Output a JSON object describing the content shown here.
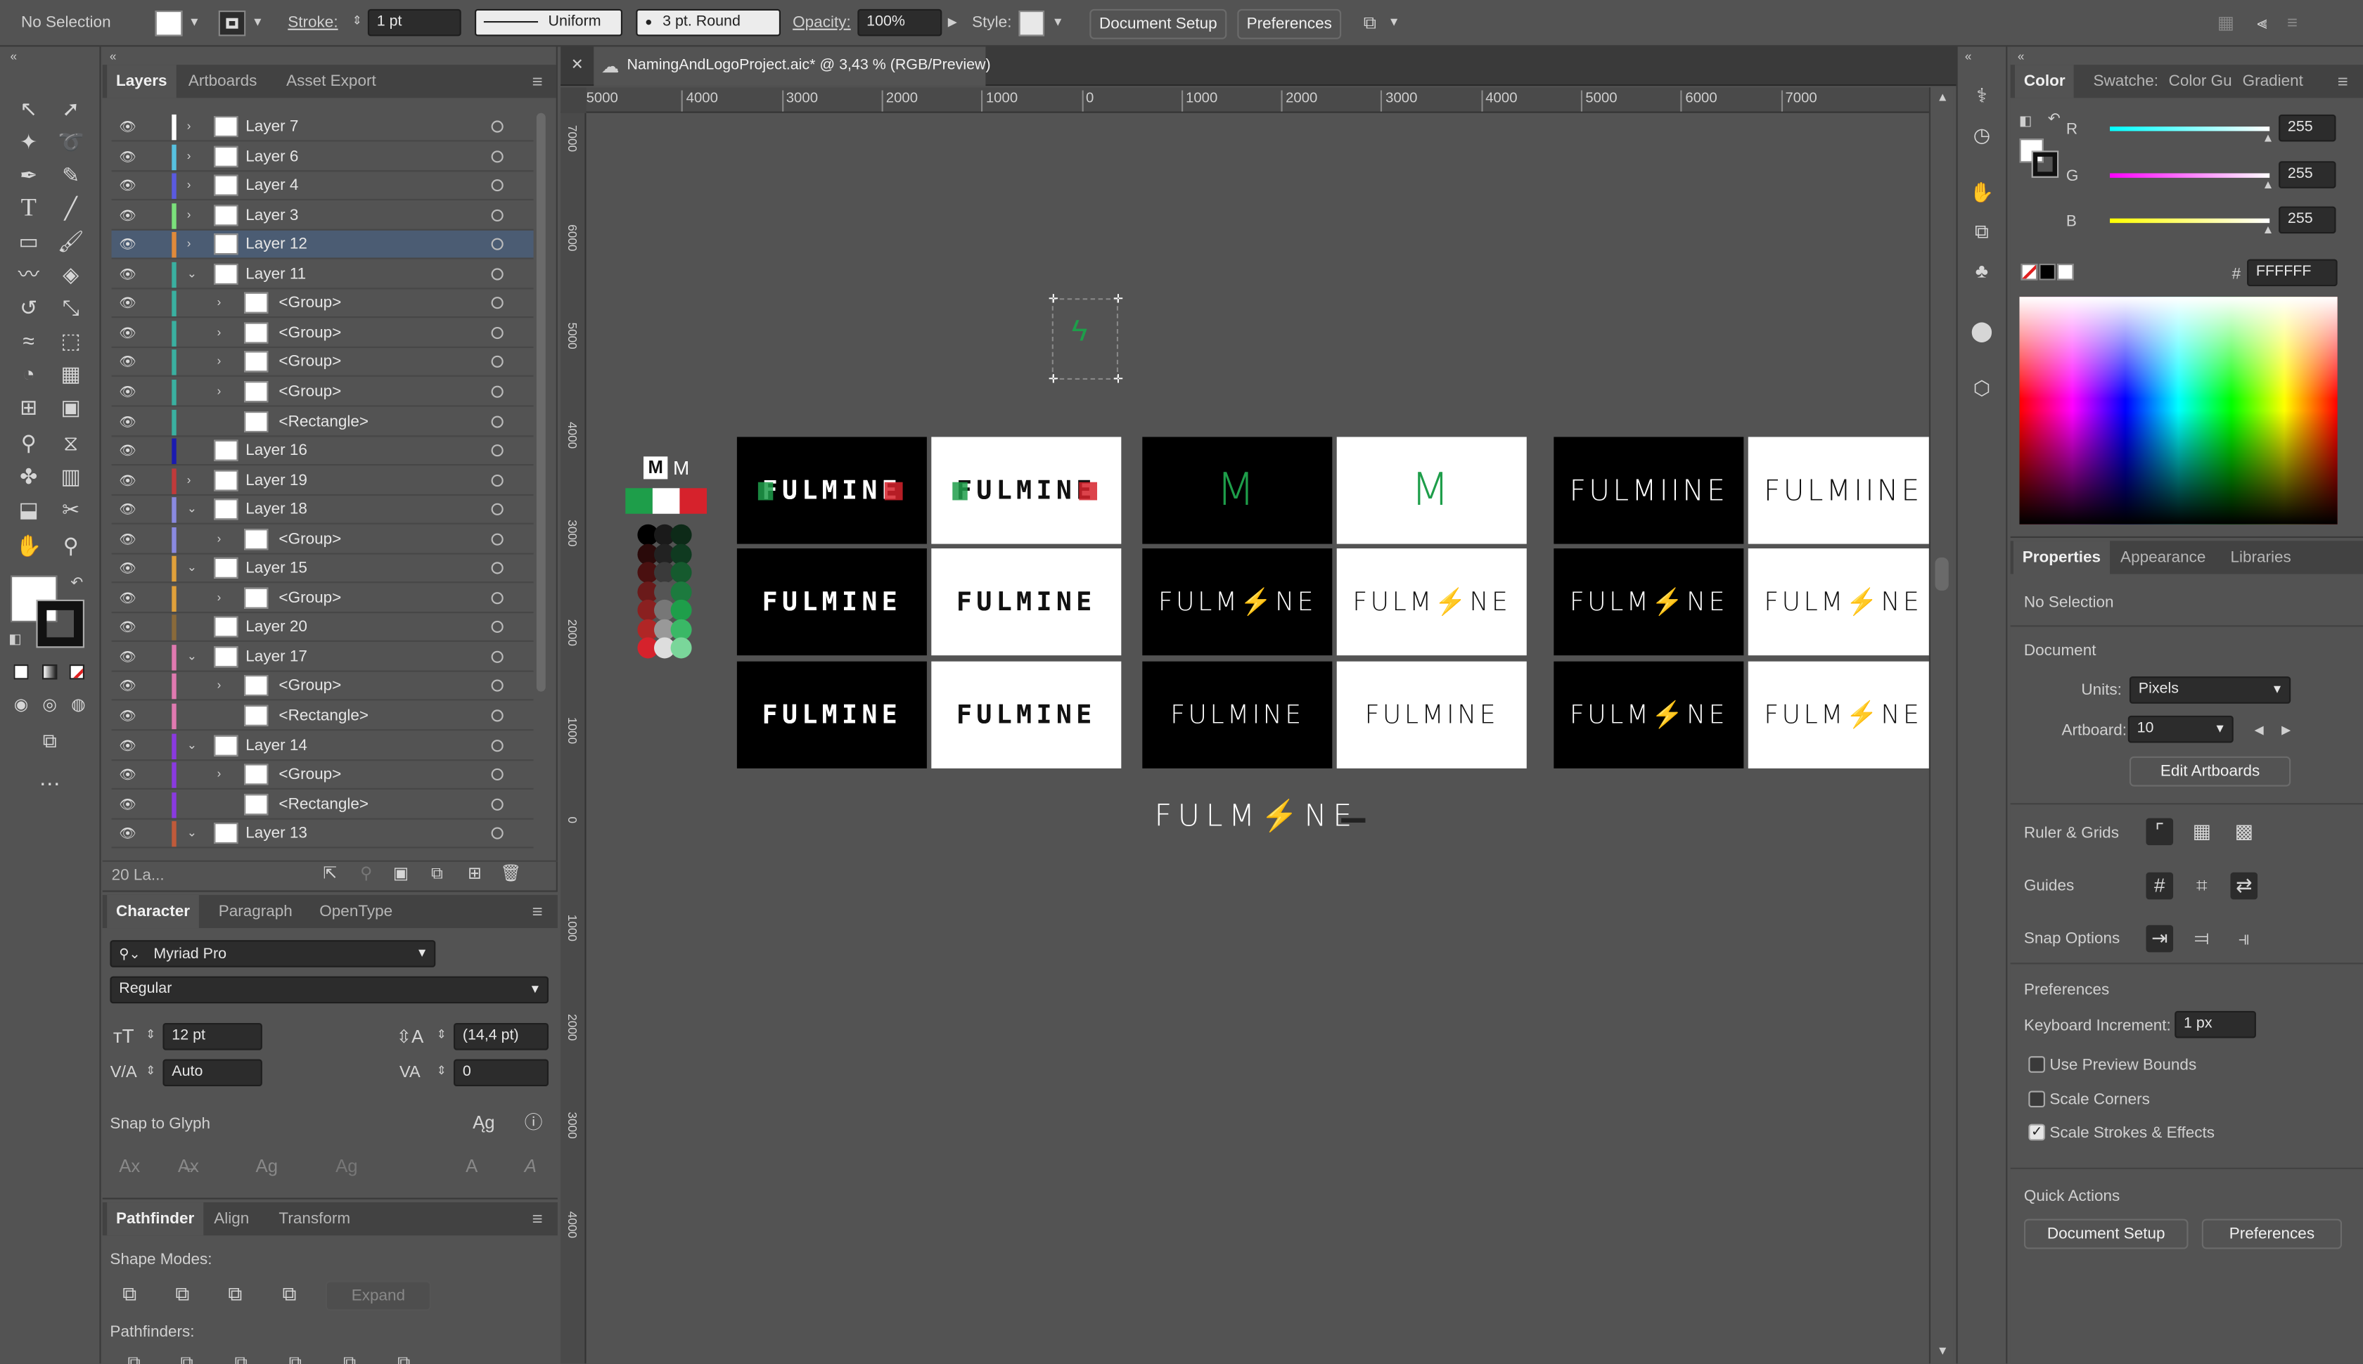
{
  "control_bar": {
    "selection": "No Selection",
    "stroke_label": "Stroke:",
    "stroke_weight": "1 pt",
    "stroke_profile": "Uniform",
    "brush": "3 pt. Round",
    "opacity_label": "Opacity:",
    "opacity_value": "100%",
    "style_label": "Style:",
    "document_setup": "Document Setup",
    "preferences": "Preferences"
  },
  "document_tab": {
    "title": "NamingAndLogoProject.aic* @ 3,43 % (RGB/Preview)"
  },
  "ruler": {
    "top_ticks": [
      "5000",
      "4000",
      "3000",
      "2000",
      "1000",
      "0",
      "1000",
      "2000",
      "3000",
      "4000",
      "5000",
      "6000",
      "7000"
    ],
    "left_ticks": [
      "7000",
      "6000",
      "5000",
      "4000",
      "3000",
      "2000",
      "1000",
      "0",
      "1000",
      "2000",
      "3000",
      "4000"
    ]
  },
  "layers_panel": {
    "tabs": [
      "Layers",
      "Artboards",
      "Asset Export"
    ],
    "rows": [
      {
        "name": "Layer 7",
        "color": "#ffffff"
      },
      {
        "name": "Layer 6",
        "color": "#57c1e0"
      },
      {
        "name": "Layer 4",
        "color": "#5a5ae0"
      },
      {
        "name": "Layer 3",
        "color": "#7be07b"
      },
      {
        "name": "Layer 12",
        "color": "#e08a3a"
      },
      {
        "name": "Layer 11",
        "color": "#3ab0a0"
      },
      {
        "name": "<Group>",
        "color": "#3ab0a0"
      },
      {
        "name": "<Group>",
        "color": "#3ab0a0"
      },
      {
        "name": "<Group>",
        "color": "#3ab0a0"
      },
      {
        "name": "<Group>",
        "color": "#3ab0a0"
      },
      {
        "name": "<Rectangle>",
        "color": "#3ab0a0"
      },
      {
        "name": "Layer 16",
        "color": "#1a1ab0"
      },
      {
        "name": "Layer 19",
        "color": "#c03a3a"
      },
      {
        "name": "Layer 18",
        "color": "#8a8ae0"
      },
      {
        "name": "<Group>",
        "color": "#8a8ae0"
      },
      {
        "name": "Layer 15",
        "color": "#e0a03a"
      },
      {
        "name": "<Group>",
        "color": "#e0a03a"
      },
      {
        "name": "Layer 20",
        "color": "#8a6a3a"
      },
      {
        "name": "Layer 17",
        "color": "#e07ab0"
      },
      {
        "name": "<Group>",
        "color": "#e07ab0"
      },
      {
        "name": "<Rectangle>",
        "color": "#e07ab0"
      },
      {
        "name": "Layer 14",
        "color": "#8a3ae0"
      },
      {
        "name": "<Group>",
        "color": "#8a3ae0"
      },
      {
        "name": "<Rectangle>",
        "color": "#8a3ae0"
      },
      {
        "name": "Layer 13",
        "color": "#c05a3a"
      }
    ],
    "footer_count": "20 La..."
  },
  "character_panel": {
    "tabs": [
      "Character",
      "Paragraph",
      "OpenType"
    ],
    "font_family": "Myriad Pro",
    "font_style": "Regular",
    "font_size": "12 pt",
    "leading": "(14,4 pt)",
    "kerning": "Auto",
    "tracking": "0",
    "snap_to_glyph": "Snap to Glyph"
  },
  "pathfinder_panel": {
    "tabs": [
      "Pathfinder",
      "Align",
      "Transform"
    ],
    "shape_modes": "Shape Modes:",
    "expand": "Expand",
    "pathfinders": "Pathfinders:"
  },
  "color_panel": {
    "tabs": [
      "Color",
      "Swatche:",
      "Color Gu",
      "Gradient"
    ],
    "r_label": "R",
    "g_label": "G",
    "b_label": "B",
    "r": "255",
    "g": "255",
    "b": "255",
    "hex_label": "#",
    "hex": "FFFFFF"
  },
  "properties_panel": {
    "tabs": [
      "Properties",
      "Appearance",
      "Libraries"
    ],
    "selection": "No Selection",
    "document_heading": "Document",
    "units_label": "Units:",
    "units_value": "Pixels",
    "artboard_label": "Artboard:",
    "artboard_value": "10",
    "edit_artboards": "Edit Artboards",
    "ruler_grids": "Ruler & Grids",
    "guides": "Guides",
    "snap_options": "Snap Options",
    "preferences_heading": "Preferences",
    "keyboard_increment_label": "Keyboard Increment:",
    "keyboard_increment_value": "1 px",
    "use_preview_bounds": "Use Preview Bounds",
    "scale_corners": "Scale Corners",
    "scale_strokes": "Scale Strokes & Effects",
    "quick_actions": "Quick Actions",
    "document_setup_btn": "Document Setup",
    "preferences_btn": "Preferences"
  },
  "canvas": {
    "artboards": [
      {
        "text": "FULMINE",
        "theme": "dark"
      },
      {
        "text": "FULMINE",
        "theme": "light"
      },
      {
        "text": "M",
        "theme": "dark"
      },
      {
        "text": "M",
        "theme": "light"
      },
      {
        "text": "FULMIINE",
        "theme": "dark"
      },
      {
        "text": "FULMIINE",
        "theme": "light"
      },
      {
        "text": "FULMINE",
        "theme": "dark"
      },
      {
        "text": "FULMINE",
        "theme": "light"
      },
      {
        "text": "FULM⚡NE",
        "theme": "dark"
      },
      {
        "text": "FULM⚡NE",
        "theme": "light"
      },
      {
        "text": "FULM⚡NE",
        "theme": "dark"
      },
      {
        "text": "FULM⚡NE",
        "theme": "light"
      },
      {
        "text": "FULMINE",
        "theme": "dark"
      },
      {
        "text": "FULMINE",
        "theme": "light"
      },
      {
        "text": "FULMINE",
        "theme": "dark"
      },
      {
        "text": "FULMINE",
        "theme": "light"
      },
      {
        "text": "FULM⚡NE",
        "theme": "dark"
      },
      {
        "text": "FULM⚡NE",
        "theme": "light"
      }
    ],
    "floating_logo": "FULM⚡NE",
    "brand_colors": {
      "green": "#1e9e4a",
      "white": "#ffffff",
      "red": "#d6222c"
    }
  }
}
